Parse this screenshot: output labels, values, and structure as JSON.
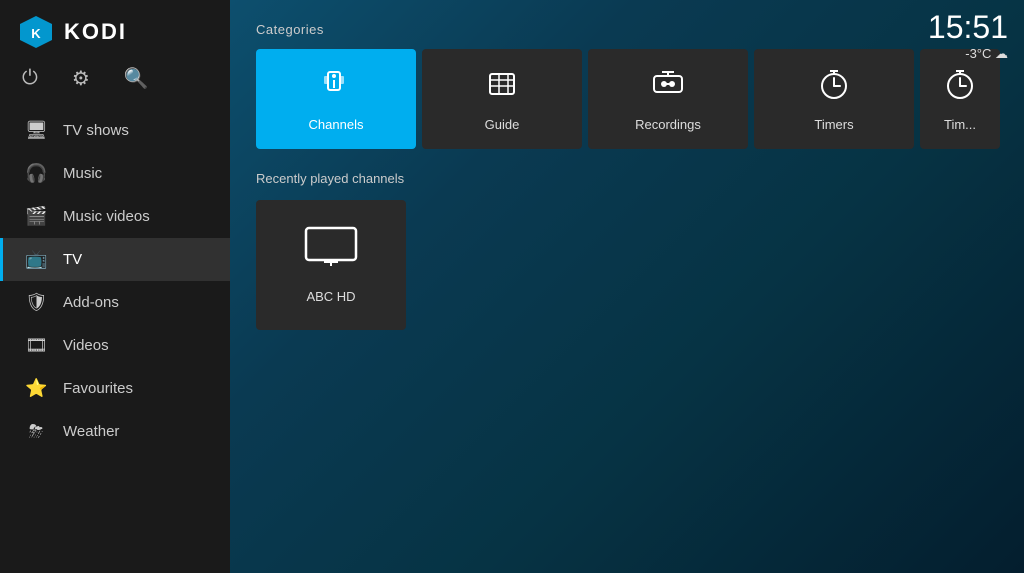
{
  "app": {
    "title": "KODI"
  },
  "clock": {
    "time": "15:51",
    "weather": "-3°C ☁"
  },
  "top_icons": {
    "power": "⏻",
    "settings": "⚙",
    "search": "🔍"
  },
  "nav": {
    "items": [
      {
        "id": "tv-shows",
        "label": "TV shows",
        "icon": "🖥"
      },
      {
        "id": "music",
        "label": "Music",
        "icon": "🎧"
      },
      {
        "id": "music-videos",
        "label": "Music videos",
        "icon": "🎬"
      },
      {
        "id": "tv",
        "label": "TV",
        "icon": "📺",
        "active": true
      },
      {
        "id": "add-ons",
        "label": "Add-ons",
        "icon": "🛡"
      },
      {
        "id": "videos",
        "label": "Videos",
        "icon": "🎞"
      },
      {
        "id": "favourites",
        "label": "Favourites",
        "icon": "⭐"
      },
      {
        "id": "weather",
        "label": "Weather",
        "icon": "⛈"
      }
    ]
  },
  "categories": {
    "label": "Categories",
    "tiles": [
      {
        "id": "channels",
        "label": "Channels",
        "icon": "🎮",
        "active": true
      },
      {
        "id": "guide",
        "label": "Guide",
        "icon": "📋",
        "active": false
      },
      {
        "id": "recordings",
        "label": "Recordings",
        "icon": "📻",
        "active": false
      },
      {
        "id": "timers",
        "label": "Timers",
        "icon": "⏱",
        "active": false
      },
      {
        "id": "timers2",
        "label": "Tim...",
        "icon": "⏱",
        "active": false
      }
    ]
  },
  "recent": {
    "label": "Recently played channels",
    "items": [
      {
        "id": "abc-hd",
        "label": "ABC HD",
        "icon": "tv"
      }
    ]
  }
}
